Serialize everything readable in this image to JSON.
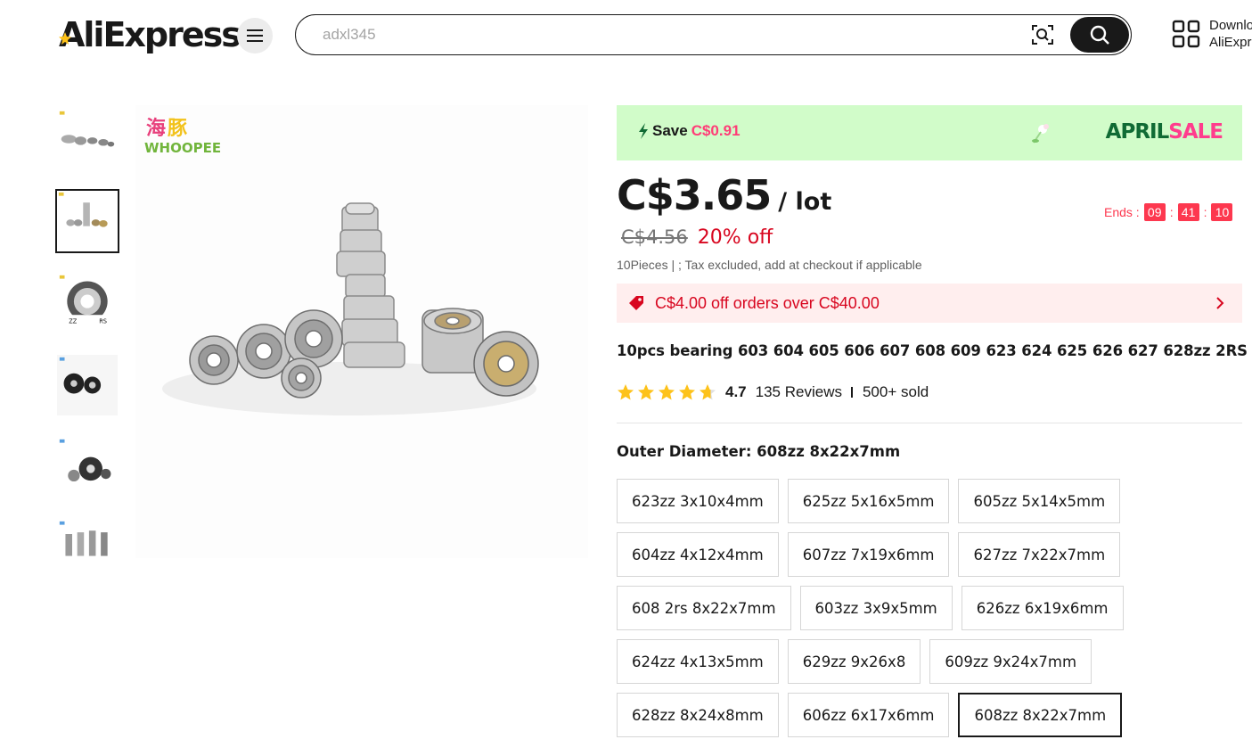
{
  "header": {
    "logo_text": "AliExpress",
    "search": {
      "value": "",
      "placeholder": "adxl345"
    },
    "download": {
      "line1": "Downlo",
      "line2": "AliExpr"
    }
  },
  "banner": {
    "save_label": "Save",
    "save_amount": "C$0.91",
    "sale_word_1": "APRIL",
    "sale_word_2": "SALE"
  },
  "price": {
    "current": "C$3.65",
    "unit": "/ lot",
    "original": "C$4.56",
    "discount": "20% off",
    "tax_note": "10Pieces | ; Tax excluded, add at checkout if applicable"
  },
  "countdown": {
    "label": "Ends :",
    "hours": "09",
    "minutes": "41",
    "seconds": "10",
    "separator": ":"
  },
  "coupon": {
    "text": "C$4.00 off orders over C$40.00"
  },
  "product": {
    "title": "10pcs bearing 603 604 605 606 607 608 609 623 624 625 626 627 628zz 2RS",
    "rating": "4.7",
    "reviews": "135 Reviews",
    "sold": "500+ sold",
    "stars_filled": 4.7
  },
  "variant_section": {
    "label": "Outer Diameter: 608zz 8x22x7mm",
    "selected": "608zz 8x22x7mm",
    "rows": [
      [
        "623zz 3x10x4mm",
        "625zz 5x16x5mm",
        "605zz 5x14x5mm"
      ],
      [
        "604zz 4x12x4mm",
        "607zz 7x19x6mm",
        "627zz 7x22x7mm"
      ],
      [
        "608 2rs 8x22x7mm",
        "603zz 3x9x5mm",
        "626zz 6x19x6mm"
      ],
      [
        "624zz 4x13x5mm",
        "629zz 9x26x8",
        "609zz 9x24x7mm"
      ],
      [
        "628zz 8x24x8mm",
        "606zz 6x17x6mm",
        "608zz 8x22x7mm"
      ]
    ]
  },
  "gallery": {
    "active_index": 1,
    "thumb_count": 6,
    "main_image_logo_icon": "whoopee-logo-icon"
  },
  "colors": {
    "banner_bg": "#d1fcc9",
    "sale_pink": "#ff3d77",
    "april_green": "#106b34",
    "price_red": "#d8061f",
    "countdown_red": "#fd384f",
    "coupon_bg": "#ffeeee",
    "star_yellow": "#fdc21a"
  }
}
